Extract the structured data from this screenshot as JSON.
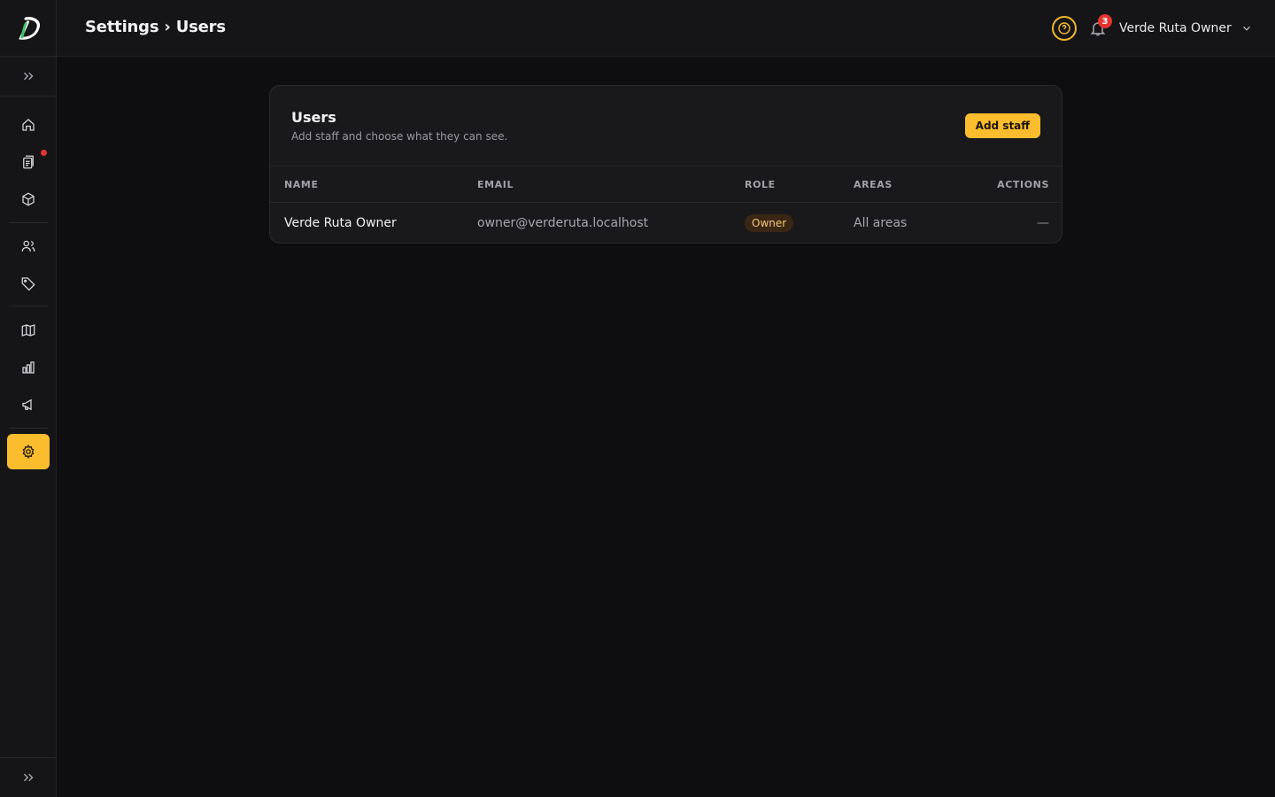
{
  "header": {
    "breadcrumb": "Settings › Users",
    "notifications_count": "3",
    "user_name": "Verde Ruta Owner"
  },
  "sidebar": {
    "items": [
      {
        "icon": "expand-icon"
      },
      {
        "icon": "home-icon"
      },
      {
        "icon": "clipboard-icon",
        "has_dot": true
      },
      {
        "icon": "box-icon"
      },
      {
        "icon": "users-icon"
      },
      {
        "icon": "tag-icon"
      },
      {
        "icon": "map-icon"
      },
      {
        "icon": "bar-chart-icon"
      },
      {
        "icon": "megaphone-icon"
      },
      {
        "icon": "gear-icon",
        "active": true
      },
      {
        "icon": "expand-icon"
      }
    ]
  },
  "card": {
    "title": "Users",
    "subtitle": "Add staff and choose what they can see.",
    "add_button": "Add staff"
  },
  "table": {
    "headers": [
      "NAME",
      "EMAIL",
      "ROLE",
      "AREAS",
      "ACTIONS"
    ],
    "rows": [
      {
        "name": "Verde Ruta Owner",
        "email": "owner@verderuta.localhost",
        "role": "Owner",
        "areas": "All areas",
        "actions": "—"
      }
    ]
  },
  "colors": {
    "accent": "#fbbd2e",
    "background": "#0e0e10",
    "panel": "#151517",
    "badge_red": "#e5342f"
  }
}
